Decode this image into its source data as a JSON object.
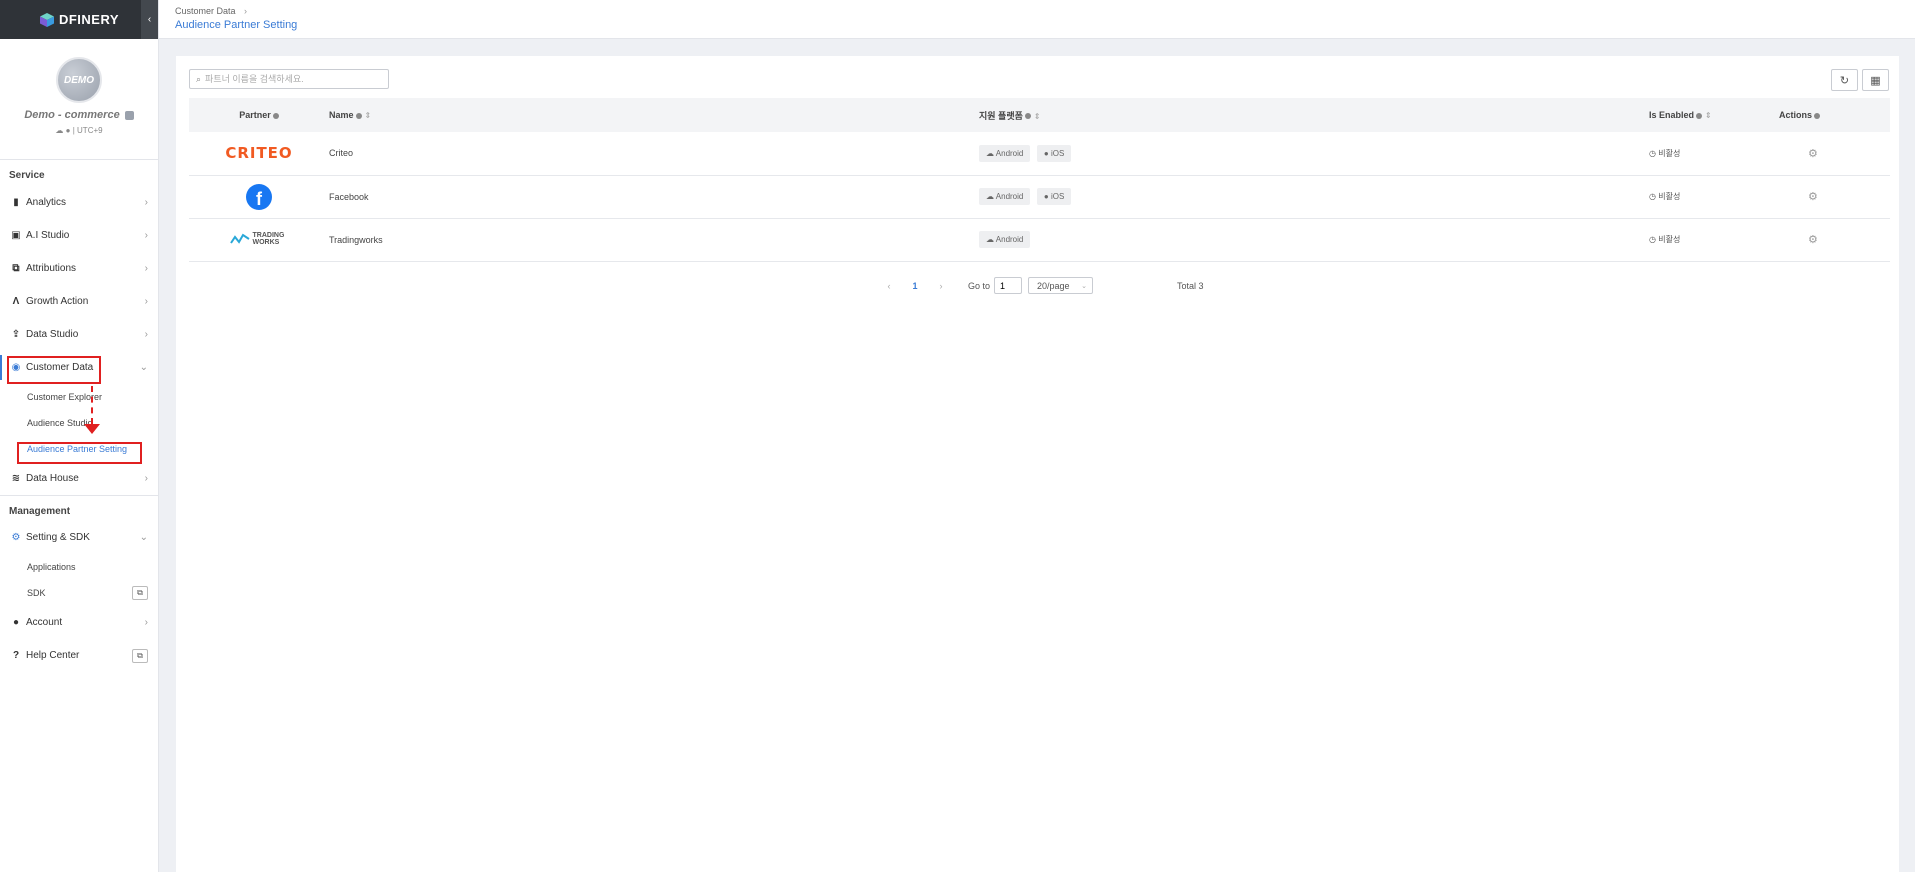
{
  "app": {
    "logo_text": "DFINERY",
    "profile": {
      "avatar_text": "DEMO",
      "name": "Demo - commerce",
      "timezone": "UTC+9"
    }
  },
  "sidebar": {
    "service_title": "Service",
    "management_title": "Management",
    "items": [
      {
        "label": "Analytics",
        "icon": "bar-chart-icon"
      },
      {
        "label": "A.I Studio",
        "icon": "ai-icon"
      },
      {
        "label": "Attributions",
        "icon": "attribution-icon"
      },
      {
        "label": "Growth Action",
        "icon": "growth-icon"
      },
      {
        "label": "Data Studio",
        "icon": "upload-icon"
      },
      {
        "label": "Customer Data",
        "icon": "target-icon"
      },
      {
        "label": "Data House",
        "icon": "database-icon"
      }
    ],
    "customer_data_sub": [
      "Customer Explorer",
      "Audience Studio",
      "Audience Partner Setting"
    ],
    "management_items": [
      {
        "label": "Setting & SDK",
        "icon": "gear-icon"
      },
      {
        "label": "Account",
        "icon": "account-icon"
      },
      {
        "label": "Help Center",
        "icon": "help-icon"
      }
    ],
    "setting_sub": [
      "Applications",
      "SDK"
    ]
  },
  "header": {
    "breadcrumb": "Customer Data",
    "title": "Audience Partner Setting"
  },
  "search": {
    "placeholder": "파트너 이름을 검색하세요."
  },
  "table": {
    "columns": [
      "Partner",
      "Name",
      "지원 플랫폼",
      "Is Enabled",
      "Actions"
    ],
    "rows": [
      {
        "partner_logo": "CRITEO",
        "name": "Criteo",
        "platforms": [
          "Android",
          "iOS"
        ],
        "status": "비활성"
      },
      {
        "partner_logo": "f",
        "name": "Facebook",
        "platforms": [
          "Android",
          "iOS"
        ],
        "status": "비활성"
      },
      {
        "partner_logo": "TRADING WORKS",
        "name": "Tradingworks",
        "platforms": [
          "Android"
        ],
        "status": "비활성"
      }
    ]
  },
  "pagination": {
    "prev": "‹",
    "current": "1",
    "next": "›",
    "goto_label": "Go to",
    "goto_value": "1",
    "page_size": "20/page",
    "total": "Total 3"
  },
  "colors": {
    "accent": "#3a7bd5",
    "annotation": "#e02020",
    "criteo": "#f15a22",
    "facebook": "#1877f2"
  }
}
